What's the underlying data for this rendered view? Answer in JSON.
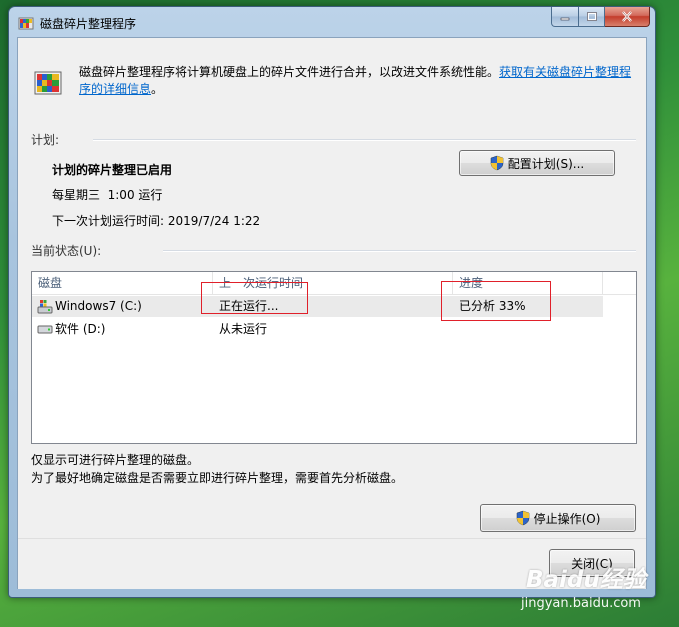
{
  "window": {
    "title": "磁盘碎片整理程序"
  },
  "intro": {
    "text": "磁盘碎片整理程序将计算机硬盘上的碎片文件进行合并，以改进文件系统性能。",
    "link": "获取有关磁盘碎片整理程序的详细信息",
    "link_suffix": "。"
  },
  "schedule": {
    "group_label": "计划:",
    "status": "计划的碎片整理已启用",
    "frequency": "每星期三  1:00 运行",
    "next_run": "下一次计划运行时间: 2019/7/24 1:22",
    "configure_button": "配置计划(S)..."
  },
  "current_status": {
    "group_label": "当前状态(U):",
    "columns": [
      "磁盘",
      "上一次运行时间",
      "进度"
    ],
    "rows": [
      {
        "disk": "Windows7 (C:)",
        "last_run": "正在运行...",
        "progress": "已分析 33%",
        "icon": "system-drive-icon",
        "selected": true
      },
      {
        "disk": "软件 (D:)",
        "last_run": "从未运行",
        "progress": "",
        "icon": "drive-icon",
        "selected": false
      }
    ]
  },
  "notes": {
    "line1": "仅显示可进行碎片整理的磁盘。",
    "line2": "为了最好地确定磁盘是否需要立即进行碎片整理，需要首先分析磁盘。"
  },
  "buttons": {
    "stop": "停止操作(O)",
    "close": "关闭(C)"
  },
  "watermark": {
    "brand": "Baidu经验",
    "url": "jingyan.baidu.com"
  },
  "colors": {
    "link": "#0066cc",
    "highlight_box": "#e0202a",
    "selected_row": "#eaeaea"
  }
}
